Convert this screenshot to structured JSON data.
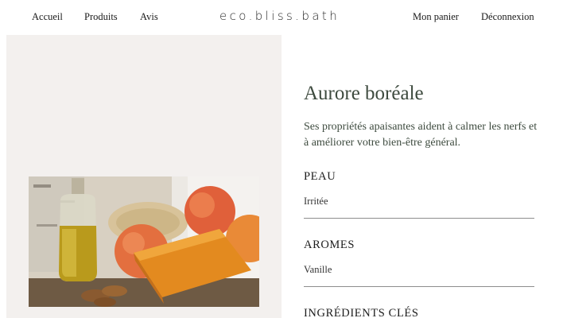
{
  "header": {
    "nav_left": [
      "Accueil",
      "Produits",
      "Avis"
    ],
    "brand": "eco.bliss.bath",
    "nav_right": [
      "Mon panier",
      "Déconnexion"
    ]
  },
  "product": {
    "title": "Aurore boréale",
    "description": "Ses propriétés apaisantes aident à calmer les nerfs et à améliorer votre bien-être général.",
    "sections": [
      {
        "label": "PEAU",
        "value": "Irritée"
      },
      {
        "label": "AROMES",
        "value": "Vanille"
      },
      {
        "label": "INGRÉDIENTS CLÉS",
        "value": ""
      }
    ]
  },
  "colors": {
    "title_green": "#3d4a3e",
    "panel_bg": "#f3f0ee",
    "divider": "#8d8d8d"
  }
}
